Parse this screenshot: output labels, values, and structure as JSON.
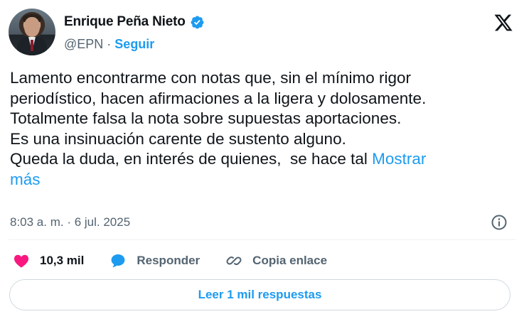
{
  "author": {
    "name": "Enrique Peña Nieto",
    "handle": "@EPN",
    "separator": "·",
    "follow_label": "Seguir",
    "avatar_icon": "profile-photo",
    "verified_icon": "verified-badge-icon"
  },
  "platform": {
    "logo_icon": "x-logo-icon"
  },
  "tweet": {
    "lines": [
      "Lamento encontrarme con notas que, sin el mínimo rigor",
      "periodístico, hacen afirmaciones a la ligera y dolosamente.",
      "Totalmente falsa la nota sobre supuestas aportaciones.",
      "Es una insinuación carente de sustento alguno.",
      "Queda la duda, en interés de quienes,  se hace tal "
    ],
    "show_more_part1": "Mostrar",
    "show_more_part2": "más",
    "timestamp": "8:03 a. m. · 6 jul. 2025"
  },
  "actions": {
    "like_count": "10,3 mil",
    "reply_label": "Responder",
    "copy_link_label": "Copia enlace"
  },
  "read_replies_label": "Leer 1 mil respuestas",
  "colors": {
    "accent": "#1d9bf0",
    "like": "#f91880",
    "text": "#0f1419",
    "muted": "#536471"
  }
}
